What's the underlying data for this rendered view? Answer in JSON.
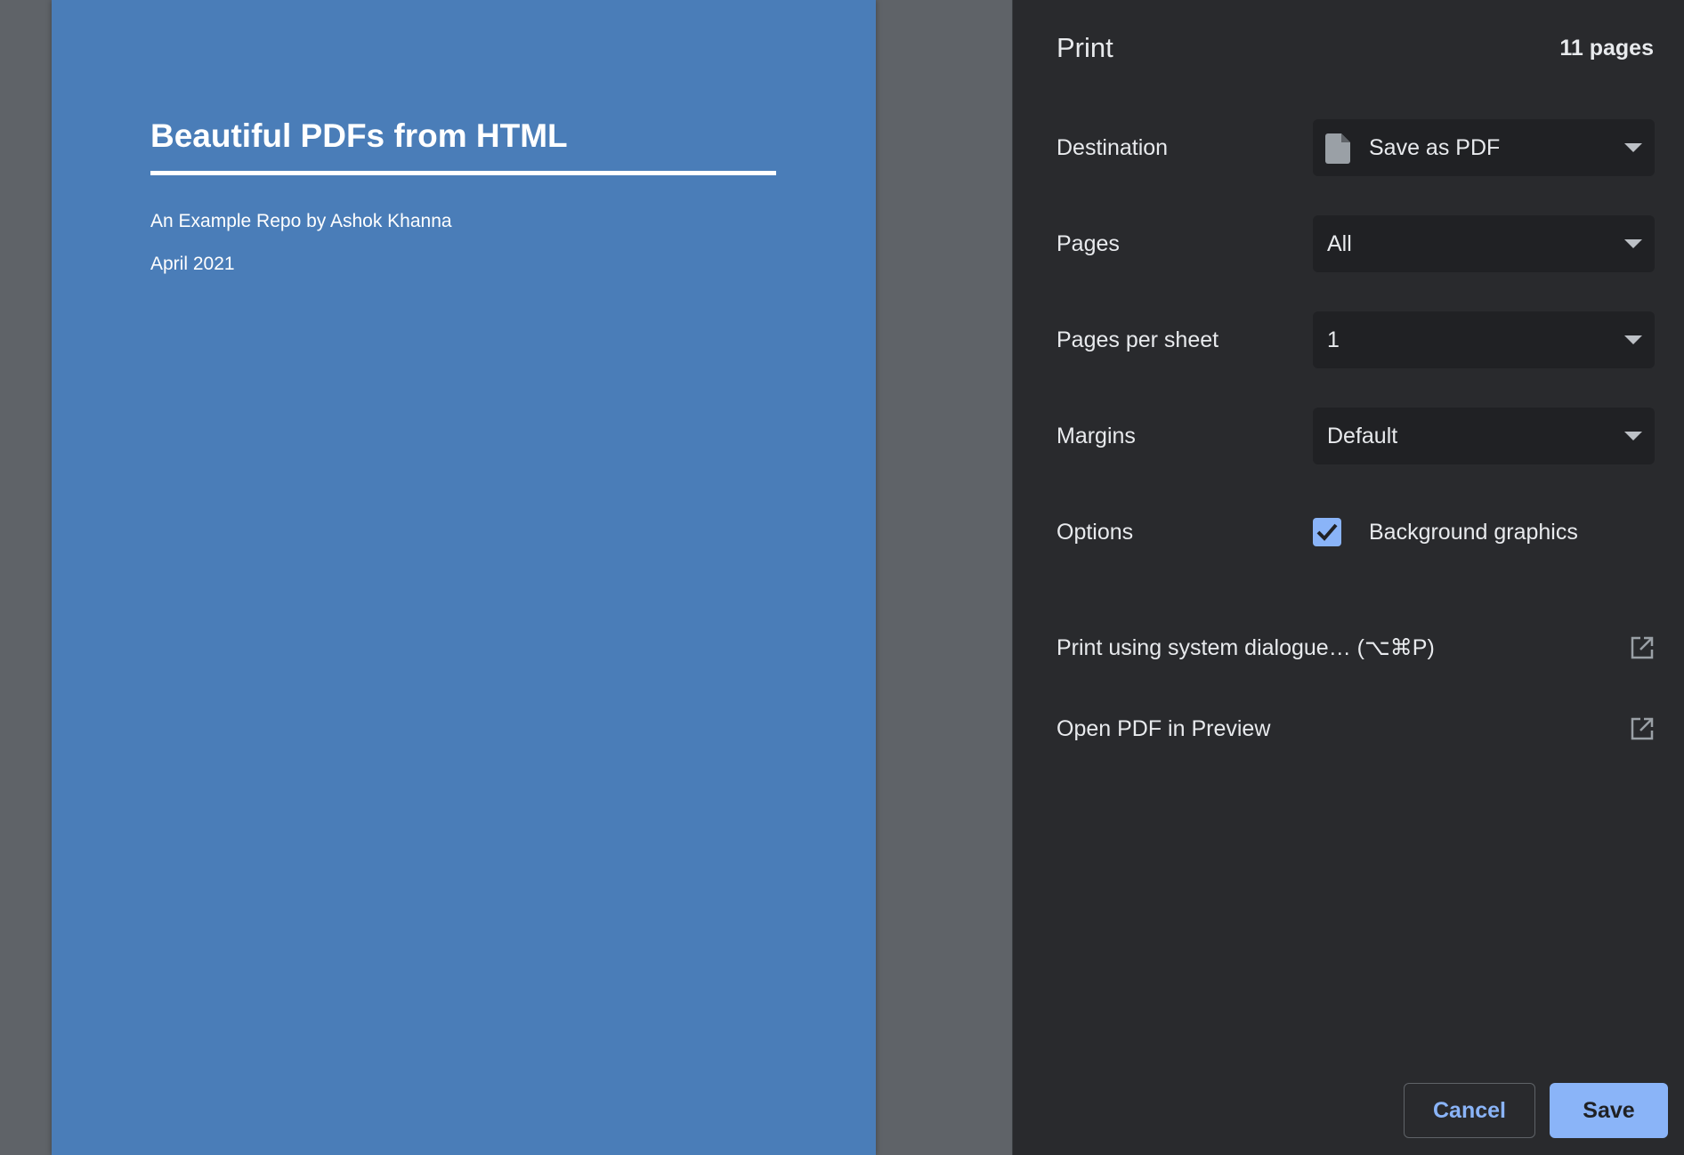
{
  "preview": {
    "page_color": "#4a7db8",
    "title": "Beautiful PDFs from HTML",
    "subtitle": "An Example Repo by Ashok Khanna",
    "date": "April 2021"
  },
  "panel": {
    "title": "Print",
    "page_count": "11 pages",
    "settings": {
      "destination": {
        "label": "Destination",
        "value": "Save as PDF",
        "icon": "file-icon"
      },
      "pages": {
        "label": "Pages",
        "value": "All"
      },
      "pages_per_sheet": {
        "label": "Pages per sheet",
        "value": "1"
      },
      "margins": {
        "label": "Margins",
        "value": "Default"
      },
      "options": {
        "label": "Options",
        "checkbox_label": "Background graphics",
        "checked": true
      }
    },
    "links": [
      {
        "label": "Print using system dialogue… (⌥⌘P)",
        "icon": "open-external-icon"
      },
      {
        "label": "Open PDF in Preview",
        "icon": "open-external-icon"
      }
    ],
    "buttons": {
      "cancel": "Cancel",
      "save": "Save"
    }
  },
  "colors": {
    "panel_bg": "#292a2d",
    "select_bg": "#202124",
    "accent": "#8ab4f8",
    "text": "#e8eaed"
  }
}
